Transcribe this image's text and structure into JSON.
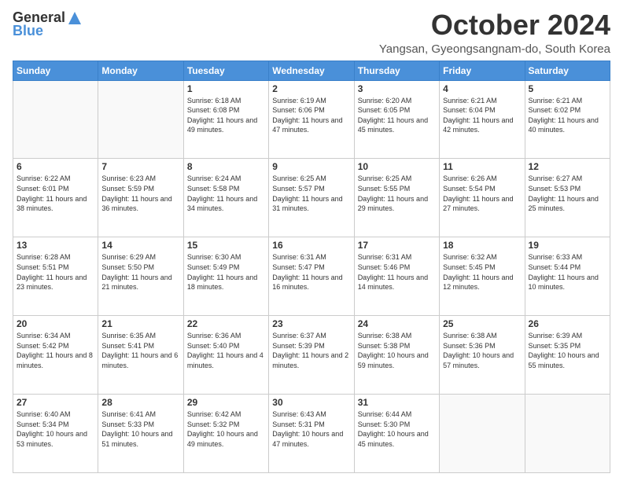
{
  "logo": {
    "general": "General",
    "blue": "Blue"
  },
  "title": "October 2024",
  "subtitle": "Yangsan, Gyeongsangnam-do, South Korea",
  "weekdays": [
    "Sunday",
    "Monday",
    "Tuesday",
    "Wednesday",
    "Thursday",
    "Friday",
    "Saturday"
  ],
  "weeks": [
    [
      {
        "day": "",
        "info": ""
      },
      {
        "day": "",
        "info": ""
      },
      {
        "day": "1",
        "info": "Sunrise: 6:18 AM\nSunset: 6:08 PM\nDaylight: 11 hours and 49 minutes."
      },
      {
        "day": "2",
        "info": "Sunrise: 6:19 AM\nSunset: 6:06 PM\nDaylight: 11 hours and 47 minutes."
      },
      {
        "day": "3",
        "info": "Sunrise: 6:20 AM\nSunset: 6:05 PM\nDaylight: 11 hours and 45 minutes."
      },
      {
        "day": "4",
        "info": "Sunrise: 6:21 AM\nSunset: 6:04 PM\nDaylight: 11 hours and 42 minutes."
      },
      {
        "day": "5",
        "info": "Sunrise: 6:21 AM\nSunset: 6:02 PM\nDaylight: 11 hours and 40 minutes."
      }
    ],
    [
      {
        "day": "6",
        "info": "Sunrise: 6:22 AM\nSunset: 6:01 PM\nDaylight: 11 hours and 38 minutes."
      },
      {
        "day": "7",
        "info": "Sunrise: 6:23 AM\nSunset: 5:59 PM\nDaylight: 11 hours and 36 minutes."
      },
      {
        "day": "8",
        "info": "Sunrise: 6:24 AM\nSunset: 5:58 PM\nDaylight: 11 hours and 34 minutes."
      },
      {
        "day": "9",
        "info": "Sunrise: 6:25 AM\nSunset: 5:57 PM\nDaylight: 11 hours and 31 minutes."
      },
      {
        "day": "10",
        "info": "Sunrise: 6:25 AM\nSunset: 5:55 PM\nDaylight: 11 hours and 29 minutes."
      },
      {
        "day": "11",
        "info": "Sunrise: 6:26 AM\nSunset: 5:54 PM\nDaylight: 11 hours and 27 minutes."
      },
      {
        "day": "12",
        "info": "Sunrise: 6:27 AM\nSunset: 5:53 PM\nDaylight: 11 hours and 25 minutes."
      }
    ],
    [
      {
        "day": "13",
        "info": "Sunrise: 6:28 AM\nSunset: 5:51 PM\nDaylight: 11 hours and 23 minutes."
      },
      {
        "day": "14",
        "info": "Sunrise: 6:29 AM\nSunset: 5:50 PM\nDaylight: 11 hours and 21 minutes."
      },
      {
        "day": "15",
        "info": "Sunrise: 6:30 AM\nSunset: 5:49 PM\nDaylight: 11 hours and 18 minutes."
      },
      {
        "day": "16",
        "info": "Sunrise: 6:31 AM\nSunset: 5:47 PM\nDaylight: 11 hours and 16 minutes."
      },
      {
        "day": "17",
        "info": "Sunrise: 6:31 AM\nSunset: 5:46 PM\nDaylight: 11 hours and 14 minutes."
      },
      {
        "day": "18",
        "info": "Sunrise: 6:32 AM\nSunset: 5:45 PM\nDaylight: 11 hours and 12 minutes."
      },
      {
        "day": "19",
        "info": "Sunrise: 6:33 AM\nSunset: 5:44 PM\nDaylight: 11 hours and 10 minutes."
      }
    ],
    [
      {
        "day": "20",
        "info": "Sunrise: 6:34 AM\nSunset: 5:42 PM\nDaylight: 11 hours and 8 minutes."
      },
      {
        "day": "21",
        "info": "Sunrise: 6:35 AM\nSunset: 5:41 PM\nDaylight: 11 hours and 6 minutes."
      },
      {
        "day": "22",
        "info": "Sunrise: 6:36 AM\nSunset: 5:40 PM\nDaylight: 11 hours and 4 minutes."
      },
      {
        "day": "23",
        "info": "Sunrise: 6:37 AM\nSunset: 5:39 PM\nDaylight: 11 hours and 2 minutes."
      },
      {
        "day": "24",
        "info": "Sunrise: 6:38 AM\nSunset: 5:38 PM\nDaylight: 10 hours and 59 minutes."
      },
      {
        "day": "25",
        "info": "Sunrise: 6:38 AM\nSunset: 5:36 PM\nDaylight: 10 hours and 57 minutes."
      },
      {
        "day": "26",
        "info": "Sunrise: 6:39 AM\nSunset: 5:35 PM\nDaylight: 10 hours and 55 minutes."
      }
    ],
    [
      {
        "day": "27",
        "info": "Sunrise: 6:40 AM\nSunset: 5:34 PM\nDaylight: 10 hours and 53 minutes."
      },
      {
        "day": "28",
        "info": "Sunrise: 6:41 AM\nSunset: 5:33 PM\nDaylight: 10 hours and 51 minutes."
      },
      {
        "day": "29",
        "info": "Sunrise: 6:42 AM\nSunset: 5:32 PM\nDaylight: 10 hours and 49 minutes."
      },
      {
        "day": "30",
        "info": "Sunrise: 6:43 AM\nSunset: 5:31 PM\nDaylight: 10 hours and 47 minutes."
      },
      {
        "day": "31",
        "info": "Sunrise: 6:44 AM\nSunset: 5:30 PM\nDaylight: 10 hours and 45 minutes."
      },
      {
        "day": "",
        "info": ""
      },
      {
        "day": "",
        "info": ""
      }
    ]
  ]
}
